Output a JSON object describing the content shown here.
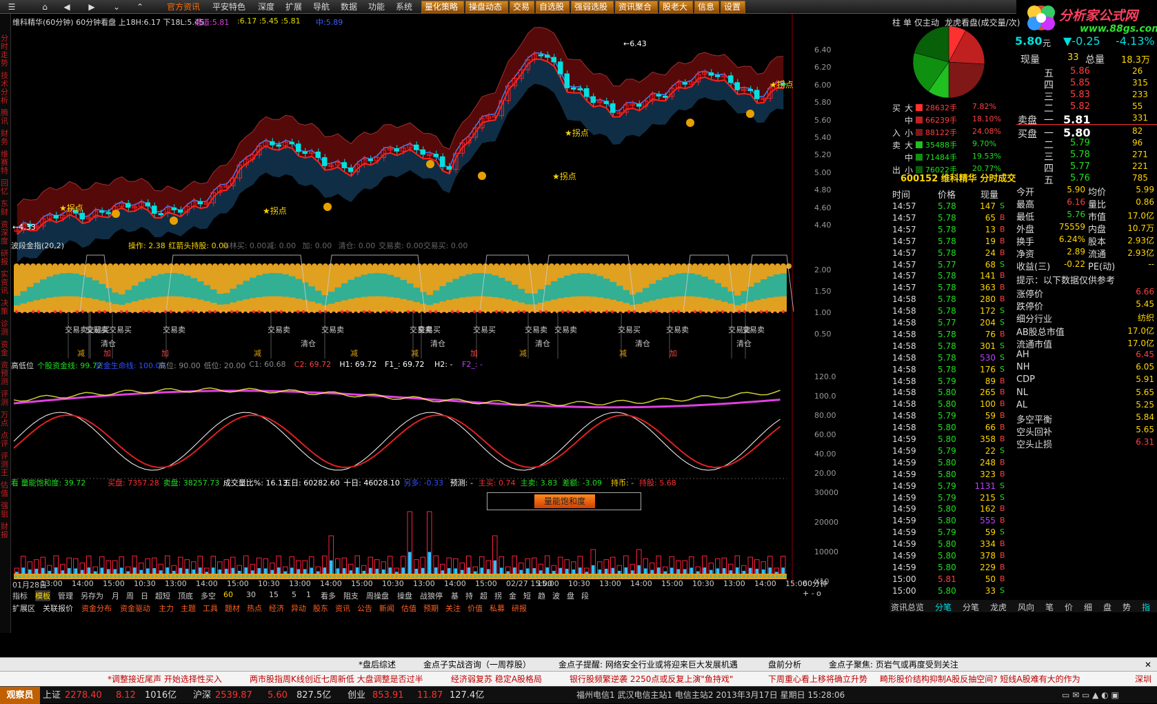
{
  "topmenu": [
    "官方资讯",
    "平安特色",
    "深度",
    "扩展",
    "导航",
    "数据",
    "功能",
    "系统"
  ],
  "toolbar": [
    "量化策略",
    "操盘动态",
    "交易",
    "自选股",
    "强弱选股",
    "资讯聚合",
    "股老大",
    "信息",
    "设置"
  ],
  "logo": {
    "text": "分析家公式网",
    "url": "www.88gs.com"
  },
  "sidebar": [
    "分时走势",
    "技术分析",
    "腾讯",
    "财务",
    "维赛特",
    "回忆",
    "东财",
    "资深度",
    "研报",
    "实资讯",
    "决策",
    "诊测",
    "资金",
    "资预测",
    "评测",
    "万点",
    "点评",
    "评测王",
    "估值",
    "强狙",
    "财报"
  ],
  "header": {
    "title": "维科精华(60分钟) 60分钟看盘 上18H:6.17 下18L:5.45",
    "tongdao": "通道:5.81",
    "vals": ":6.17  :5.45  :5.81",
    "mid": "中:5.89"
  },
  "price_axis": [
    "6.40",
    "6.20",
    "6.00",
    "5.80",
    "5.60",
    "5.40",
    "5.20",
    "5.00",
    "4.80",
    "4.60",
    "4.40"
  ],
  "price_marks": {
    "high": "6.43",
    "low": "4.33",
    "guai": "拐点"
  },
  "panel2": {
    "title": "波段金指(20,2)",
    "items": [
      "操作: 2.38",
      "红箭头持股: 0.00",
      "布林买: 0.00",
      "减: 0.00",
      "加: 0.00",
      "清仓: 0.00",
      "交易卖: 0.00",
      "交易买: 0.00"
    ],
    "axis": [
      "2.00",
      "1.50",
      "1.00",
      "0.50"
    ],
    "signals": [
      "交易卖",
      "交易买",
      "交易买",
      "交易卖",
      "交易卖",
      "交易卖",
      "交易卖",
      "交易买",
      "交易卖",
      "交易卖",
      "交易买",
      "交易卖",
      "交易卖",
      "交易卖",
      "交易卖",
      "交易买"
    ],
    "clear": "清仓",
    "jian": "减",
    "jia": "加"
  },
  "panel3": {
    "title": "高低位",
    "items": [
      "个股资金线: 99.72",
      "资金生命线: 100.00",
      "高位: 90.00",
      "低位: 20.00",
      "C1: 60.68",
      "C2: 69.72",
      "H1: 69.72",
      "F1_: 69.72",
      "H2: -",
      "F2_: -"
    ],
    "axis": [
      "120.0",
      "100.0",
      "80.00",
      "60.00",
      "40.00",
      "20.00"
    ]
  },
  "panel4": {
    "title": "看  量能饱和度: 39.72",
    "items": [
      "买盘: 7357.28",
      "卖盘: 38257.73",
      "成交量比%: 16.13",
      "五日: 60282.60",
      "十日: 46028.10",
      "另多: -0.33",
      "预测: -",
      "主买: 0.74",
      "主卖: 3.83",
      "差额: -3.09",
      "持币: -",
      "持股: 5.68"
    ],
    "button": "量能饱和度",
    "axis": [
      "30000",
      "20000",
      "10000",
      "X10"
    ]
  },
  "time_axis": [
    "01月28日",
    "13:00",
    "14:00",
    "15:00",
    "10:30",
    "13:00",
    "14:00",
    "15:00",
    "10:30",
    "13:00",
    "14:00",
    "15:00",
    "10:30",
    "13:00",
    "14:00",
    "15:00",
    "02/27 15:00",
    "15:00",
    "10:30",
    "13:00",
    "14:00",
    "15:00",
    "10:30",
    "13:00",
    "14:00",
    "15:00"
  ],
  "bottom_tabs": [
    "指标",
    "模板",
    "管理",
    "另存为",
    "月",
    "周",
    "日",
    "超短",
    "顶底",
    "多空",
    "60",
    "30",
    "15",
    "5",
    "1",
    "看多",
    "阻支",
    "周操盘",
    "操盘",
    "战狼停",
    "基",
    "持",
    "超",
    "拐",
    "金",
    "短",
    "趋",
    "波",
    "盘",
    "段"
  ],
  "bottom_tabs2": [
    "扩展区",
    "关联报价",
    "资金分布",
    "资金驱动",
    "主力",
    "主题",
    "工具",
    "题材",
    "热点",
    "经济",
    "异动",
    "股东",
    "资讯",
    "公告",
    "新闻",
    "估值",
    "预期",
    "关注",
    "价值",
    "私募",
    "研报"
  ],
  "right": {
    "header": [
      "柱",
      "单",
      "仅主动",
      "龙虎看盘(成交量/次)"
    ],
    "flow": [
      {
        "g": "买",
        "s": "大",
        "v": "28632手",
        "p": "7.82%"
      },
      {
        "g": "",
        "s": "中",
        "v": "66239手",
        "p": "18.10%"
      },
      {
        "g": "入",
        "s": "小",
        "v": "88122手",
        "p": "24.08%"
      },
      {
        "g": "卖",
        "s": "大",
        "v": "35488手",
        "p": "9.70%"
      },
      {
        "g": "",
        "s": "中",
        "v": "71484手",
        "p": "19.53%"
      },
      {
        "g": "出",
        "s": "小",
        "v": "76022手",
        "p": "20.77%"
      }
    ],
    "stock_title": "600152 维科精华 分时成交",
    "quote": {
      "price": "5.80",
      "unit": "元",
      "chg": "▼-0.25",
      "pct": "-4.13%",
      "xianliang_label": "现量",
      "xianliang": "33",
      "zongliang_label": "总量",
      "zongliang": "18.3万"
    },
    "sell": [
      {
        "l": "五",
        "p": "5.86",
        "v": "26"
      },
      {
        "l": "四",
        "p": "5.85",
        "v": "315"
      },
      {
        "l": "三",
        "p": "5.83",
        "v": "233"
      },
      {
        "l": "二",
        "p": "5.82",
        "v": "55"
      },
      {
        "l": "一",
        "p": "5.81",
        "v": "331"
      }
    ],
    "buy": [
      {
        "l": "一",
        "p": "5.80",
        "v": "82"
      },
      {
        "l": "二",
        "p": "5.79",
        "v": "96"
      },
      {
        "l": "三",
        "p": "5.78",
        "v": "271"
      },
      {
        "l": "四",
        "p": "5.77",
        "v": "221"
      },
      {
        "l": "五",
        "p": "5.76",
        "v": "785"
      }
    ],
    "sell_label": "卖盘",
    "buy_label": "买盘",
    "trade_headers": [
      "时间",
      "价格",
      "现量"
    ],
    "trades": [
      [
        "14:57",
        "5.78",
        "147",
        "S"
      ],
      [
        "14:57",
        "5.78",
        "65",
        "B"
      ],
      [
        "14:57",
        "5.78",
        "13",
        "B"
      ],
      [
        "14:57",
        "5.78",
        "19",
        "B"
      ],
      [
        "14:57",
        "5.78",
        "24",
        "B"
      ],
      [
        "14:57",
        "5.77",
        "68",
        "S"
      ],
      [
        "14:57",
        "5.78",
        "141",
        "B"
      ],
      [
        "14:57",
        "5.78",
        "363",
        "B"
      ],
      [
        "14:58",
        "5.78",
        "280",
        "B"
      ],
      [
        "14:58",
        "5.78",
        "172",
        "S"
      ],
      [
        "14:58",
        "5.77",
        "204",
        "S"
      ],
      [
        "14:58",
        "5.78",
        "76",
        "B"
      ],
      [
        "14:58",
        "5.78",
        "301",
        "S"
      ],
      [
        "14:58",
        "5.78",
        "530",
        "S"
      ],
      [
        "14:58",
        "5.78",
        "176",
        "S"
      ],
      [
        "14:58",
        "5.79",
        "89",
        "B"
      ],
      [
        "14:58",
        "5.80",
        "265",
        "B"
      ],
      [
        "14:58",
        "5.80",
        "100",
        "B"
      ],
      [
        "14:58",
        "5.79",
        "59",
        "B"
      ],
      [
        "14:58",
        "5.80",
        "66",
        "B"
      ],
      [
        "14:59",
        "5.80",
        "358",
        "B"
      ],
      [
        "14:59",
        "5.79",
        "22",
        "S"
      ],
      [
        "14:59",
        "5.80",
        "248",
        "B"
      ],
      [
        "14:59",
        "5.80",
        "323",
        "B"
      ],
      [
        "14:59",
        "5.79",
        "1131",
        "S"
      ],
      [
        "14:59",
        "5.79",
        "215",
        "S"
      ],
      [
        "14:59",
        "5.80",
        "162",
        "B"
      ],
      [
        "14:59",
        "5.80",
        "555",
        "B"
      ],
      [
        "14:59",
        "5.79",
        "59",
        "S"
      ],
      [
        "14:59",
        "5.80",
        "334",
        "B"
      ],
      [
        "14:59",
        "5.80",
        "378",
        "B"
      ],
      [
        "14:59",
        "5.80",
        "229",
        "B"
      ],
      [
        "15:00",
        "5.81",
        "50",
        "B"
      ],
      [
        "15:00",
        "5.80",
        "33",
        "S"
      ]
    ],
    "stats": [
      {
        "a": "今开",
        "av": "5.90",
        "b": "均价",
        "bv": "5.99"
      },
      {
        "a": "最高",
        "av": "6.16",
        "b": "量比",
        "bv": "0.86"
      },
      {
        "a": "最低",
        "av": "5.76",
        "b": "市值",
        "bv": "17.0亿"
      },
      {
        "a": "外盘",
        "av": "75559",
        "b": "内盘",
        "bv": "10.7万"
      },
      {
        "a": "换手",
        "av": "6.24%",
        "b": "股本",
        "bv": "2.93亿"
      },
      {
        "a": "净资",
        "av": "2.89",
        "b": "流通",
        "bv": "2.93亿"
      },
      {
        "a": "收益(三)",
        "av": "-0.22",
        "b": "PE(动)",
        "bv": "--"
      }
    ],
    "tip": "提示：以下数据仅供参考",
    "extra": [
      {
        "k": "涨停价",
        "v": "6.66"
      },
      {
        "k": "跌停价",
        "v": "5.45"
      },
      {
        "k": "细分行业",
        "v": "纺织"
      },
      {
        "k": "AB股总市值",
        "v": "17.0亿"
      },
      {
        "k": "流通市值",
        "v": "17.0亿"
      },
      {
        "k": "AH",
        "v": "6.45"
      },
      {
        "k": "NH",
        "v": "6.05"
      },
      {
        "k": "CDP",
        "v": "5.91"
      },
      {
        "k": "NL",
        "v": "5.65"
      },
      {
        "k": "AL",
        "v": "5.25"
      },
      {
        "k": "多空平衡",
        "v": "5.84"
      },
      {
        "k": "空头回补",
        "v": "5.65"
      },
      {
        "k": "空头止损",
        "v": "6.31"
      }
    ],
    "bottom_tabs": [
      "资讯总览",
      "分笔",
      "分笔",
      "龙虎",
      "风向",
      "笔",
      "价",
      "细",
      "盘",
      "势",
      "指",
      "值",
      "筹"
    ]
  },
  "period": "60分钟",
  "status": [
    "*盘后综述",
    "金点子实战咨询（一周荐股）",
    "金点子提醒: 网络安全行业或将迎来巨大发展机遇",
    "盘前分析",
    "金点子聚焦: 页岩气或再度受到关注"
  ],
  "news": [
    "*调整接近尾声  开始选择性买入",
    "两市股指周K线创近七周新低  大盘调整是否过半",
    "经济弱复苏  稳定A股格局",
    "银行股频繁逆袭  2250点或反复上演\"鱼持戏\"",
    "下周重心看上移将确立升势",
    "畸形股价结构抑制A股反抽空间?  短线A股难有大的作为",
    "深圳"
  ],
  "bottom": {
    "guest": "观察员",
    "sh_label": "上证",
    "sh": "2278.40",
    "sh_chg": "8.12",
    "sh_amt": "1016亿",
    "hs_label": "沪深",
    "hs": "2539.87",
    "hs_chg": "5.60",
    "hs_amt": "827.5亿",
    "cy_label": "创业",
    "cy": "853.91",
    "cy_chg": "11.87",
    "cy_amt": "127.4亿",
    "server": "福州电信1  武汉电信主站1  电信主站2  2013年3月17日  星期日  15:28:06"
  },
  "colors": {
    "up": "#ff3030",
    "down": "#00e0e0",
    "accent": "#ff8c00",
    "yellow": "#ffff00"
  }
}
